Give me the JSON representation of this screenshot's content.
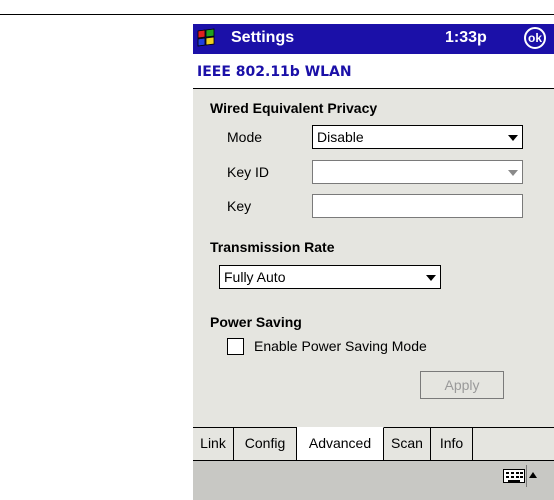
{
  "window": {
    "title": "Settings",
    "clock": "1:33p",
    "ok_label": "ok"
  },
  "page": {
    "header": "IEEE 802.11b WLAN"
  },
  "wep": {
    "section_title": "Wired Equivalent Privacy",
    "mode_label": "Mode",
    "mode_value": "Disable",
    "keyid_label": "Key ID",
    "keyid_value": "",
    "key_label": "Key",
    "key_value": ""
  },
  "transmission": {
    "section_title": "Transmission Rate",
    "value": "Fully Auto"
  },
  "power": {
    "section_title": "Power Saving",
    "checkbox_label": "Enable Power Saving Mode",
    "checked": false
  },
  "apply_label": "Apply",
  "tabs": [
    {
      "label": "Link",
      "active": false
    },
    {
      "label": "Config",
      "active": false
    },
    {
      "label": "Advanced",
      "active": true
    },
    {
      "label": "Scan",
      "active": false
    },
    {
      "label": "Info",
      "active": false
    }
  ],
  "colors": {
    "titlebar": "#1b10a8",
    "header_text": "#1b10a8",
    "panel": "#e5e5e0"
  },
  "icons": {
    "start": "windows-flag-icon",
    "sip": "keyboard-icon"
  }
}
